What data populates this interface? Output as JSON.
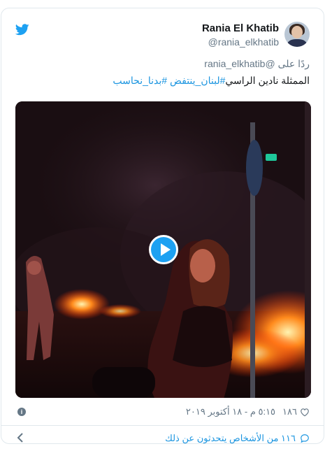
{
  "author": {
    "name": "Rania El Khatib",
    "handle": "@rania_elkhatib"
  },
  "tweet": {
    "reply_prefix": "ردًا على",
    "reply_to": "@rania_elkhatib",
    "text_plain": "الممثلة نادين الراسي",
    "hashtags": [
      "#لبنان_ينتفض",
      "#بدنا_نحاسب"
    ]
  },
  "media": {
    "type": "video"
  },
  "footer": {
    "likes": "١٨٦",
    "timestamp": "٥:١٥ م - ١٨ أكتوبر ٢٠١٩",
    "info_glyph": "i",
    "conversation_label": "١١٦ من الأشخاص يتحدثون عن ذلك"
  },
  "colors": {
    "brand": "#1da1f2",
    "link": "#1b95e0",
    "muted": "#657786",
    "border": "#e1e8ed"
  }
}
